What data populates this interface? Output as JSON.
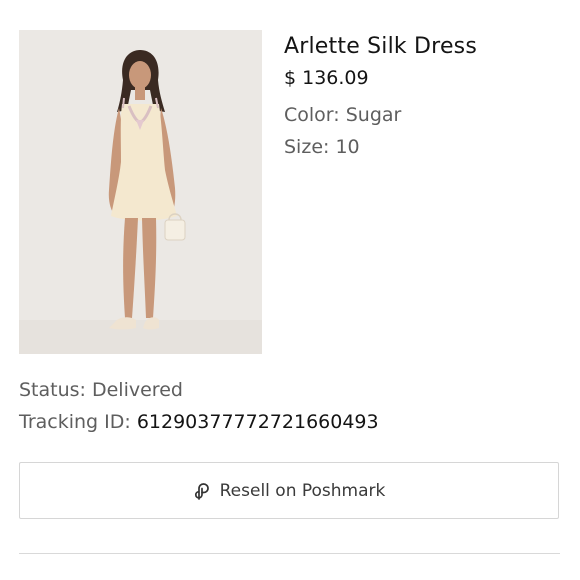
{
  "product": {
    "name": "Arlette Silk Dress",
    "price": "$ 136.09",
    "color_line": "Color: Sugar",
    "size_line": "Size: 10"
  },
  "order": {
    "status_line": "Status: Delivered",
    "tracking_label": "Tracking ID: ",
    "tracking_id": "61290377772721660493"
  },
  "actions": {
    "resell_label": "Resell on Poshmark",
    "resell_icon": "poshmark-icon"
  }
}
